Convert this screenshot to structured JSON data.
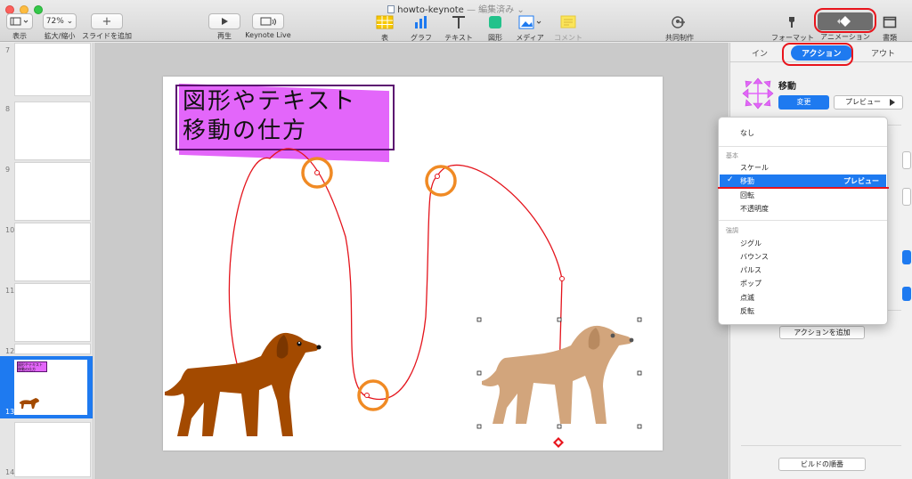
{
  "window": {
    "title": "howto-keynote",
    "edited": " — 編集済み ⌄"
  },
  "toolbar": {
    "view_label": "表示",
    "zoom_value": "72%",
    "zoom_label": "拡大/縮小",
    "add_slide_label": "スライドを追加",
    "play_label": "再生",
    "keynote_live_label": "Keynote Live",
    "table_label": "表",
    "chart_label": "グラフ",
    "text_label": "テキスト",
    "shape_label": "図形",
    "media_label": "メディア",
    "comment_label": "コメント",
    "collaborate_label": "共同制作",
    "format_label": "フォーマット",
    "animate_label": "アニメーション",
    "document_label": "書類"
  },
  "navigator": {
    "slide_numbers": [
      "7",
      "8",
      "9",
      "10",
      "11",
      "12",
      "13",
      "14"
    ],
    "selected": "13"
  },
  "slide": {
    "title_line1": "図形やテキスト",
    "title_line2": "移動の仕方",
    "thumb_title": "図形やテキスト\n移動の仕方"
  },
  "inspector": {
    "tab_in": "イン",
    "tab_action": "アクション",
    "tab_out": "アウト",
    "effect_name": "移動",
    "change_button": "変更",
    "preview_button": "プレビュー",
    "add_action_button": "アクションを追加",
    "build_order_button": "ビルドの順番"
  },
  "effect_menu": {
    "none": "なし",
    "basic_header": "基本",
    "basic_items": [
      "スケール",
      "移動",
      "回転",
      "不透明度"
    ],
    "selected_item": "移動",
    "selected_preview": "プレビュー",
    "emphasis_header": "強調",
    "emphasis_items": [
      "ジグル",
      "バウンス",
      "パルス",
      "ポップ",
      "点滅",
      "反転"
    ]
  },
  "colors": {
    "accent_blue": "#1e7af0",
    "annotation_red": "#e8141c",
    "path_red": "#e4141c",
    "marker_orange": "#f08a24",
    "dog_brown": "#a34a00",
    "dog_tan": "#d2a57c",
    "title_magenta": "#e366fa",
    "title_border": "#5b1270"
  },
  "icons": [
    "sidebar-view-icon",
    "play-icon",
    "keynote-live-icon",
    "table-icon",
    "chart-icon",
    "text-icon",
    "shape-icon",
    "media-icon",
    "comment-icon",
    "collaborate-icon",
    "format-brush-icon",
    "animate-diamond-icon",
    "document-icon",
    "move-arrows-icon"
  ]
}
